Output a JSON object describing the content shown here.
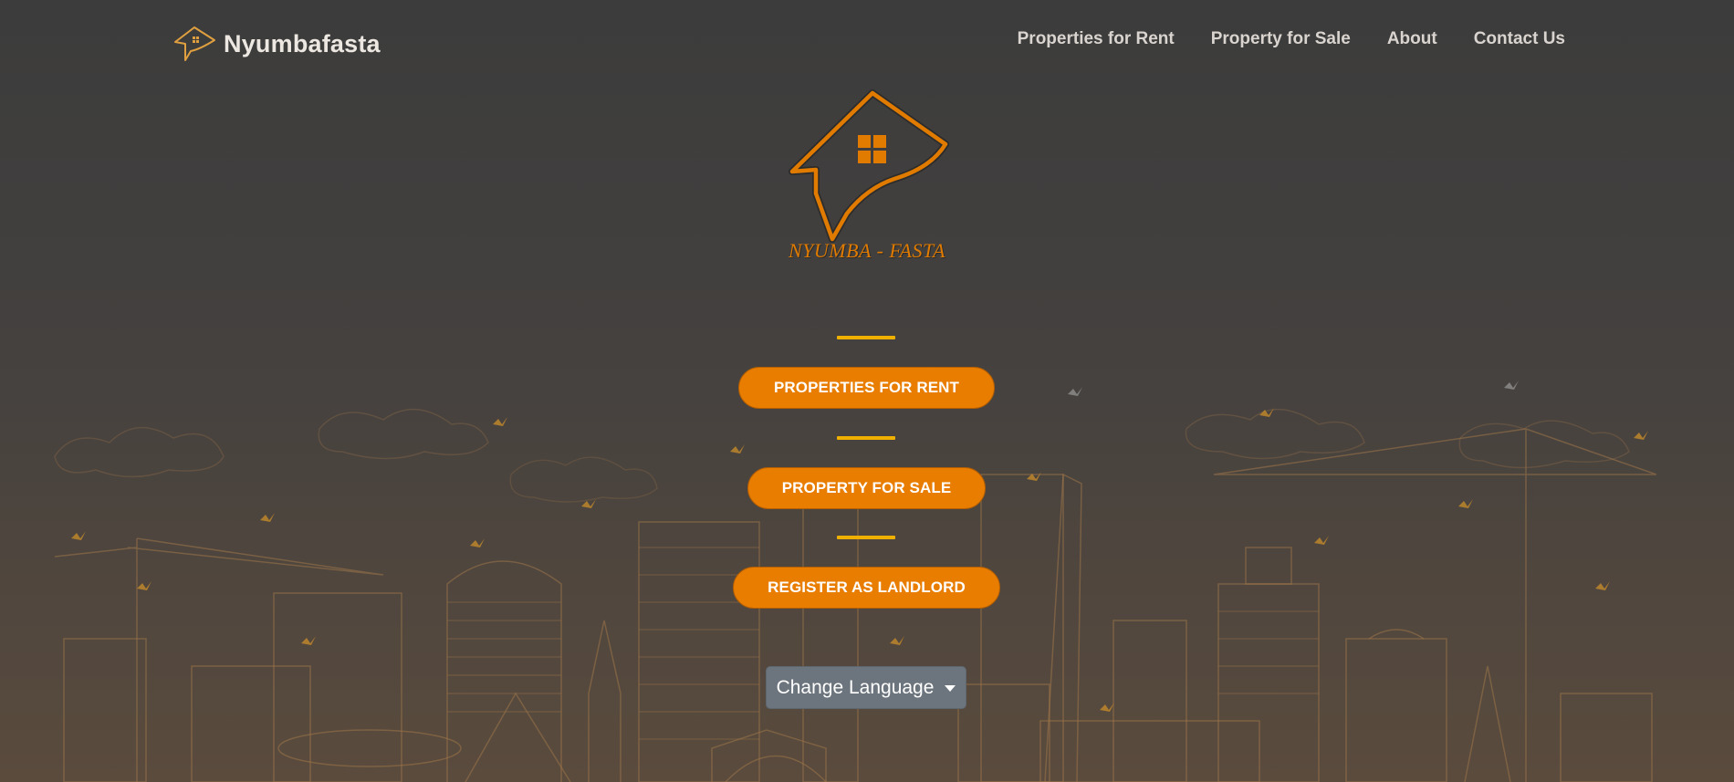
{
  "navbar": {
    "brand": "Nyumbafasta",
    "links": [
      {
        "label": "Properties for Rent"
      },
      {
        "label": "Property for Sale"
      },
      {
        "label": "About"
      },
      {
        "label": "Contact Us"
      }
    ]
  },
  "hero": {
    "logo_caption": "NYUMBA - FASTA",
    "buttons": {
      "rent": "PROPERTIES FOR RENT",
      "sale": "PROPERTY FOR SALE",
      "landlord": "REGISTER AS LANDLORD"
    },
    "language_button": "Change Language"
  },
  "colors": {
    "accent": "#e87d00",
    "divider": "#f0b000",
    "language_button": "#6c757d",
    "skyline_line": "#a5784a"
  },
  "icons": [
    "house-logo-icon",
    "chevron-down-icon"
  ]
}
